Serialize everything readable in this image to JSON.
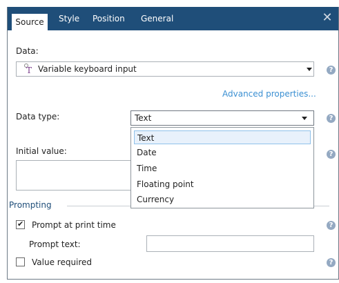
{
  "tabs": [
    {
      "label": "Source"
    },
    {
      "label": "Style"
    },
    {
      "label": "Position"
    },
    {
      "label": "General"
    }
  ],
  "close_label": "✕",
  "data_section": {
    "label": "Data:",
    "selected": "Variable keyboard input",
    "advanced_link": "Advanced properties..."
  },
  "data_type": {
    "label": "Data type:",
    "selected": "Text",
    "options": [
      "Text",
      "Date",
      "Time",
      "Floating point",
      "Currency"
    ]
  },
  "initial_value": {
    "label": "Initial value:",
    "value": ""
  },
  "prompting": {
    "section_label": "Prompting",
    "prompt_at_print_label": "Prompt at print time",
    "prompt_at_print_checked": true,
    "prompt_text_label": "Prompt text:",
    "prompt_text_value": "",
    "value_required_label": "Value required",
    "value_required_checked": false
  },
  "help_glyph": "?",
  "check_glyph": "✔",
  "colors": {
    "header": "#1f4e79",
    "link": "#3a8fd2",
    "help": "#94a9c2",
    "selection_bg": "#e8f1fb",
    "selection_border": "#8fc1ea"
  }
}
